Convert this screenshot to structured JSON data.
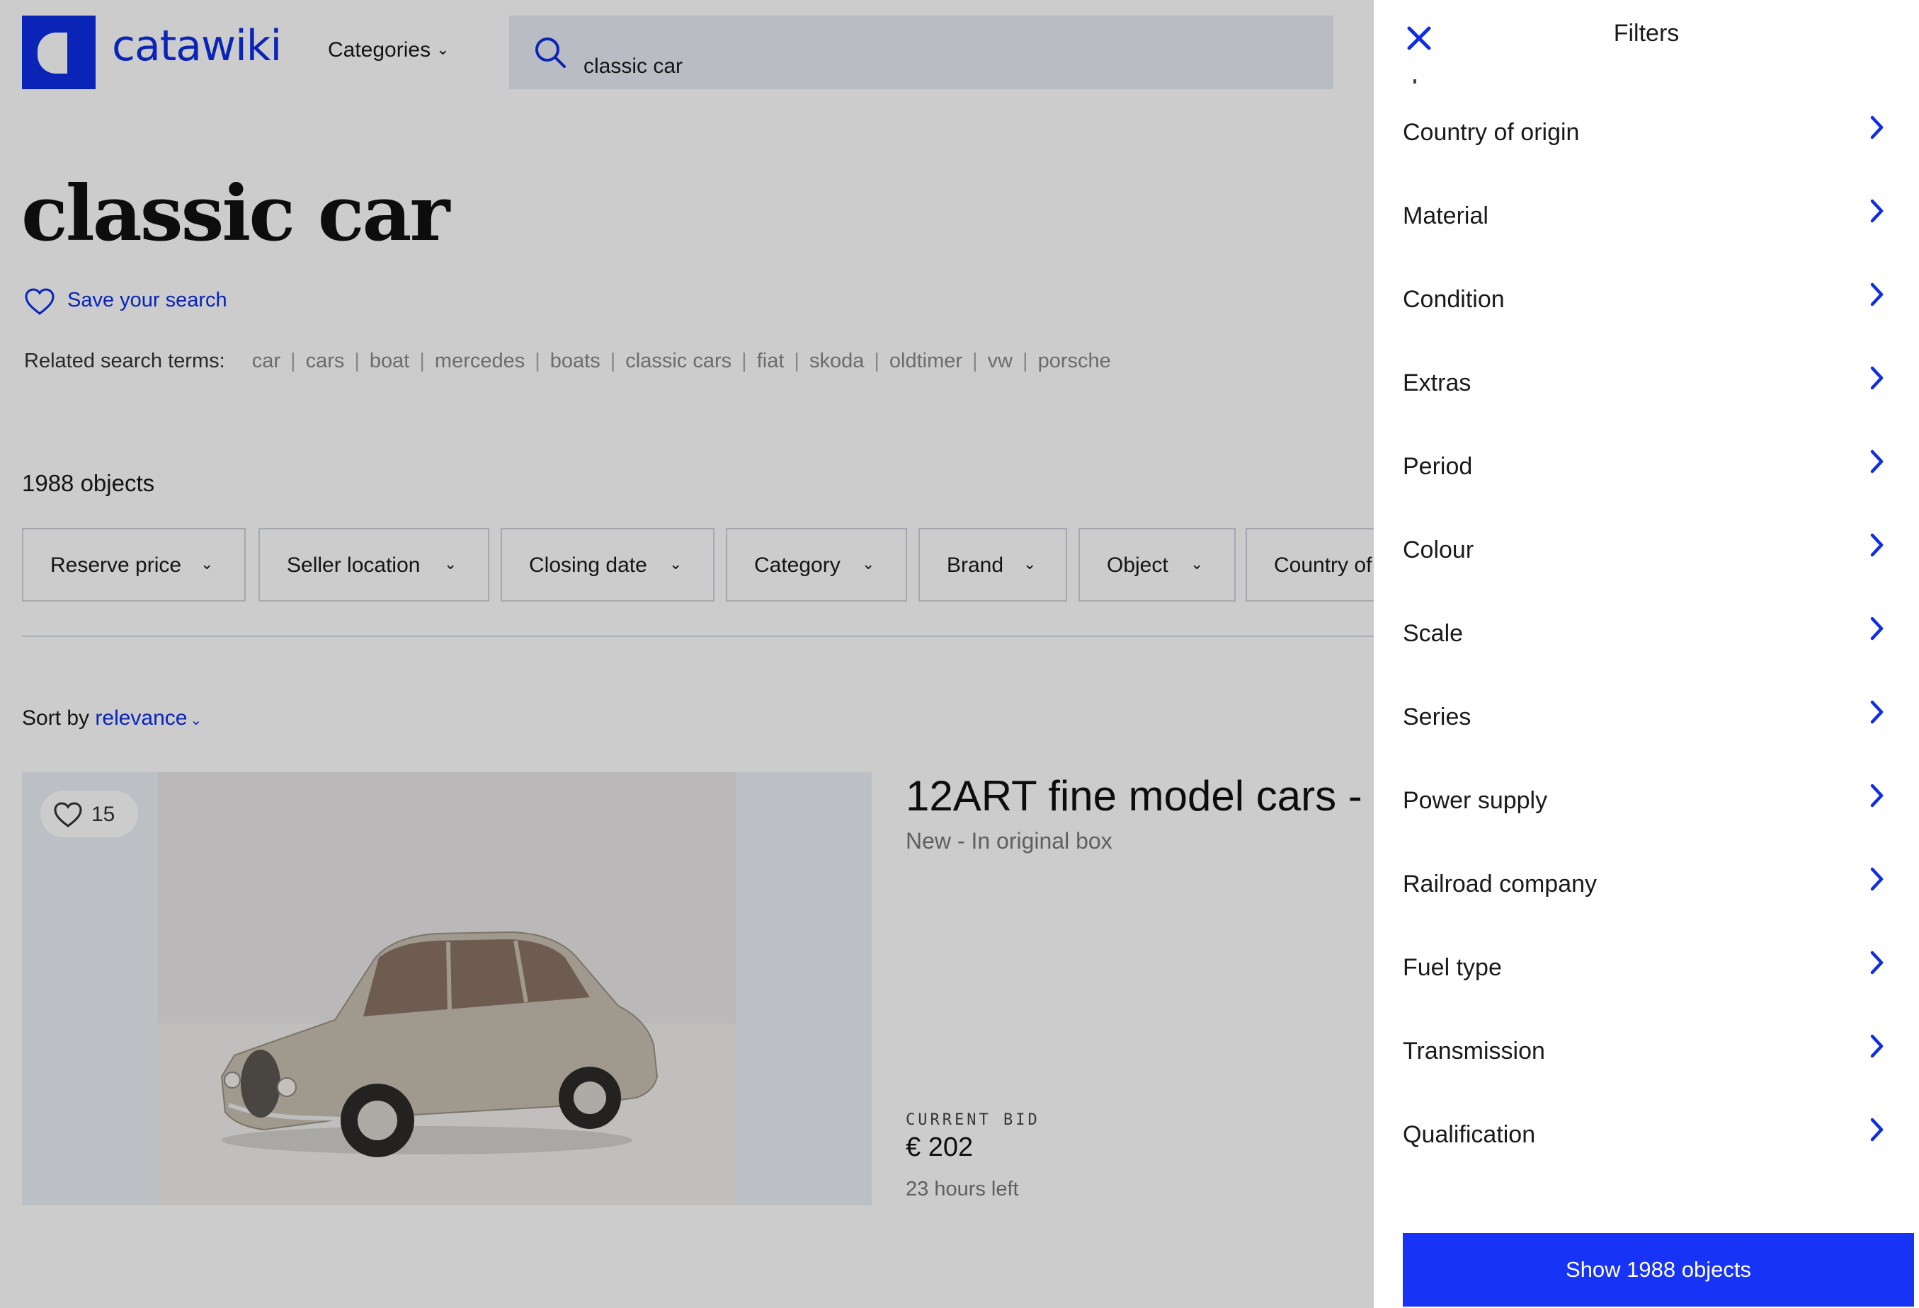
{
  "header": {
    "logo_text": "catawiki",
    "categories_label": "Categories",
    "search_value": "classic car"
  },
  "search": {
    "title": "classic car",
    "save_label": "Save your search",
    "related_label": "Related search terms:",
    "related_terms": [
      "car",
      "cars",
      "boat",
      "mercedes",
      "boats",
      "classic cars",
      "fiat",
      "skoda",
      "oldtimer",
      "vw",
      "porsche"
    ],
    "object_count": "1988 objects"
  },
  "filter_buttons": [
    "Reserve price",
    "Seller location",
    "Closing date",
    "Category",
    "Brand",
    "Object",
    "Country of"
  ],
  "sort": {
    "label": "Sort by",
    "value": "relevance"
  },
  "listing": {
    "favorites": "15",
    "title": "12ART fine model cars -",
    "subtitle": "New - In original box",
    "bid_label": "CURRENT BID",
    "bid_value": "€ 202",
    "time_left": "23 hours left"
  },
  "panel": {
    "title": "Filters",
    "items": [
      "Country of origin",
      "Material",
      "Condition",
      "Extras",
      "Period",
      "Colour",
      "Scale",
      "Series",
      "Power supply",
      "Railroad company",
      "Fuel type",
      "Transmission",
      "Qualification"
    ],
    "show_button": "Show 1988 objects"
  },
  "colors": {
    "brand_blue": "#0d2de6",
    "button_blue": "#1733f5"
  }
}
